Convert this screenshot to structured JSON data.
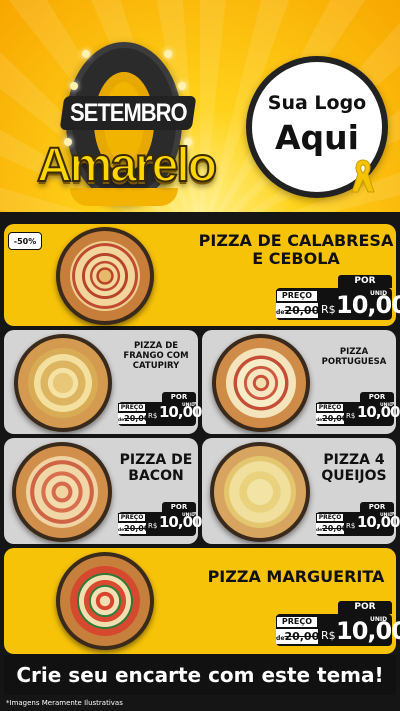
{
  "header": {
    "badge_top": "SETEMBRO",
    "badge_word": "Amarelo",
    "logo_line1": "Sua Logo",
    "logo_line2": "Aqui"
  },
  "discount_badge": "-50%",
  "products": [
    {
      "name_line1": "PIZZA DE CALABRESA",
      "name_line2": "E CEBOLA",
      "por": "POR",
      "preco": "PREÇO",
      "de": "de",
      "old_price": "20,00",
      "currency": "R$",
      "price": "10,00",
      "unit": "UNID"
    },
    {
      "name_line1": "PIZZA DE",
      "name_line2": "FRANGO COM",
      "name_line3": "CATUPIRY",
      "por": "POR",
      "preco": "PREÇO",
      "de": "de",
      "old_price": "20,00",
      "currency": "R$",
      "price": "10,00",
      "unit": "UNID"
    },
    {
      "name_line1": "PIZZA",
      "name_line2": "PORTUGUESA",
      "por": "POR",
      "preco": "PREÇO",
      "de": "de",
      "old_price": "20,00",
      "currency": "R$",
      "price": "10,00",
      "unit": "UNID"
    },
    {
      "name_line1": "PIZZA DE",
      "name_line2": "BACON",
      "por": "POR",
      "preco": "PREÇO",
      "de": "de",
      "old_price": "20,00",
      "currency": "R$",
      "price": "10,00",
      "unit": "UNID"
    },
    {
      "name_line1": "PIZZA 4",
      "name_line2": "QUEIJOS",
      "por": "POR",
      "preco": "PREÇO",
      "de": "de",
      "old_price": "20,00",
      "currency": "R$",
      "price": "10,00",
      "unit": "UNID"
    },
    {
      "name_line1": "PIZZA MARGUERITA",
      "por": "POR",
      "preco": "PREÇO",
      "de": "de",
      "old_price": "20,00",
      "currency": "R$",
      "price": "10,00",
      "unit": "UNID"
    }
  ],
  "cta": "Crie seu encarte com este tema!",
  "footnote": "*Imagens Meramente Ilustrativas",
  "colors": {
    "yellow": "#f7c308",
    "gray": "#d4d4d4",
    "dark": "#151515"
  }
}
